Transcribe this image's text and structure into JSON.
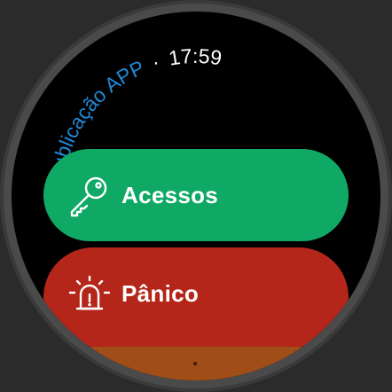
{
  "header": {
    "app_name": "Publicação APP",
    "separator": "·",
    "time": "17:59"
  },
  "menu": [
    {
      "label": "Acessos",
      "icon": "key-icon",
      "color": "#0fa965"
    },
    {
      "label": "Pânico",
      "icon": "siren-alarm-icon",
      "color": "#b32619"
    },
    {
      "label": "",
      "icon": "",
      "color": "#a14d18"
    }
  ],
  "colors": {
    "app_name": "#1e88d6",
    "time": "#ffffff",
    "background": "#000000"
  }
}
